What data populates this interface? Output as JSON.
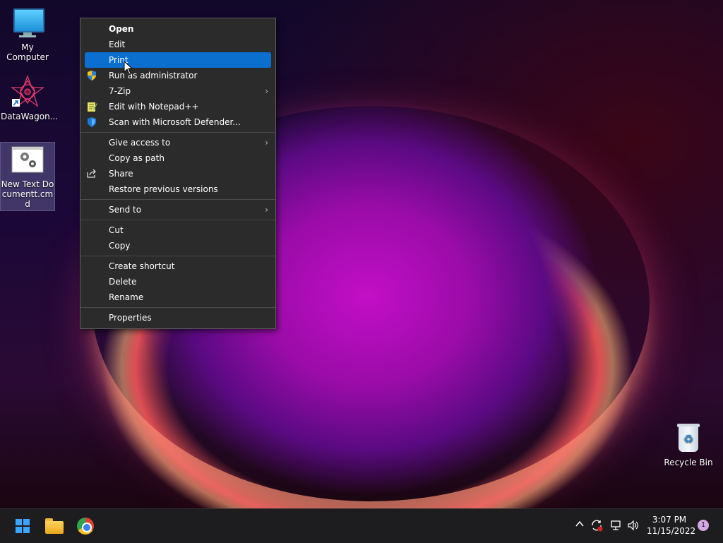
{
  "desktop": {
    "icons": [
      {
        "label": "My Computer"
      },
      {
        "label": "DataWagon..."
      },
      {
        "label": "New Text Documentt.cmd"
      },
      {
        "label": "Recycle Bin"
      }
    ]
  },
  "context_menu": {
    "items": [
      {
        "label": "Open"
      },
      {
        "label": "Edit"
      },
      {
        "label": "Print"
      },
      {
        "label": "Run as administrator"
      },
      {
        "label": "7-Zip"
      },
      {
        "label": "Edit with Notepad++"
      },
      {
        "label": "Scan with Microsoft Defender..."
      },
      {
        "label": "Give access to"
      },
      {
        "label": "Copy as path"
      },
      {
        "label": "Share"
      },
      {
        "label": "Restore previous versions"
      },
      {
        "label": "Send to"
      },
      {
        "label": "Cut"
      },
      {
        "label": "Copy"
      },
      {
        "label": "Create shortcut"
      },
      {
        "label": "Delete"
      },
      {
        "label": "Rename"
      },
      {
        "label": "Properties"
      }
    ],
    "submenu_arrow": "›",
    "icons": {
      "shield": "shield-icon",
      "notepad": "notepad-icon",
      "defender": "defender-icon",
      "share": "share-icon"
    }
  },
  "taskbar": {
    "tray_up_arrow": "^",
    "clock_time": "3:07 PM",
    "clock_date": "11/15/2022",
    "notification_count": "1"
  },
  "colors": {
    "highlight": "#0a6fcf",
    "menu_bg": "#2b2b2b",
    "taskbar_bg": "#1d1d1f"
  }
}
